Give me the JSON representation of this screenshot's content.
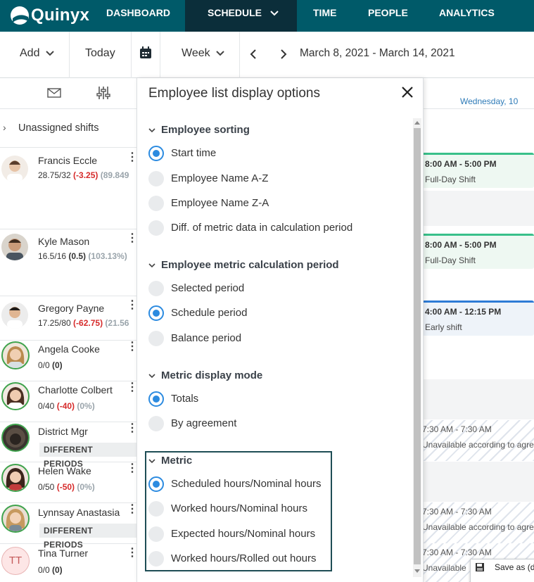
{
  "nav": {
    "brand": "Quinyx",
    "items": [
      "DASHBOARD",
      "SCHEDULE",
      "TIME",
      "PEOPLE",
      "ANALYTICS"
    ],
    "active": "SCHEDULE",
    "colors": {
      "bar": "#005a69",
      "active": "#0b2e3a"
    }
  },
  "toolbar": {
    "add": "Add",
    "today": "Today",
    "view": "Week",
    "date_range": "March 8, 2021 - March 14, 2021"
  },
  "left": {
    "unassigned": "Unassigned shifts",
    "employees": [
      {
        "name": "Francis Eccle",
        "stat_a": "28.75/32 ",
        "stat_b": "(-3.25)",
        "stat_c": " (89.849"
      },
      {
        "name": "Kyle Mason",
        "stat_a": "16.5/16 ",
        "stat_b": "(0.5)",
        "stat_c": " (103.13%)"
      },
      {
        "name": "Gregory Payne",
        "stat_a": "17.25/80 ",
        "stat_b": "(-62.75)",
        "stat_c": " (21.56"
      },
      {
        "name": "Angela Cooke",
        "stat_a": "0/0 ",
        "stat_b": "(0)",
        "stat_c": ""
      },
      {
        "name": "Charlotte Colbert",
        "stat_a": "0/40 ",
        "stat_b": "(-40)",
        "stat_c": " (0%)"
      },
      {
        "name": "District Mgr",
        "badge": "DIFFERENT PERIODS"
      },
      {
        "name": "Helen Wake",
        "stat_a": "0/50 ",
        "stat_b": "(-50)",
        "stat_c": " (0%)"
      },
      {
        "name": "Lynnsay Anastasia",
        "badge": "DIFFERENT PERIODS"
      },
      {
        "name": "Tina Turner",
        "initials": "TT",
        "stat_a": "0/0 ",
        "stat_b": "(0)",
        "stat_c": ""
      }
    ]
  },
  "grid": {
    "day": "Wednesday, 10",
    "shifts": [
      {
        "time": "8:00 AM - 5:00 PM",
        "name": "Full-Day Shift"
      },
      {
        "time": "8:00 AM - 5:00 PM",
        "name": "Full-Day Shift"
      },
      {
        "time": "4:00 AM - 12:15 PM",
        "name": "Early shift"
      }
    ],
    "unavailable": [
      {
        "time": "7:30 AM - 7:30 AM",
        "text": "Unavailable according to agre"
      },
      {
        "time": "7:30 AM - 7:30 AM",
        "text": "Unavailable according to agre"
      },
      {
        "time": "7:30 AM - 7:30 AM",
        "text": "Unavailable"
      }
    ],
    "save_as": "Save as (di"
  },
  "panel": {
    "title": "Employee list display options",
    "sections": [
      {
        "title": "Employee sorting",
        "options": [
          "Start time",
          "Employee Name A-Z",
          "Employee Name Z-A",
          "Diff. of metric data in calculation period"
        ],
        "selected": 0
      },
      {
        "title": "Employee metric calculation period",
        "options": [
          "Selected period",
          "Schedule period",
          "Balance period"
        ],
        "selected": 1
      },
      {
        "title": "Metric display mode",
        "options": [
          "Totals",
          "By agreement"
        ],
        "selected": 0
      },
      {
        "title": "Metric",
        "options": [
          "Scheduled hours/Nominal hours",
          "Worked hours/Nominal hours",
          "Expected hours/Nominal hours",
          "Worked hours/Rolled out hours"
        ],
        "selected": 0
      }
    ]
  }
}
